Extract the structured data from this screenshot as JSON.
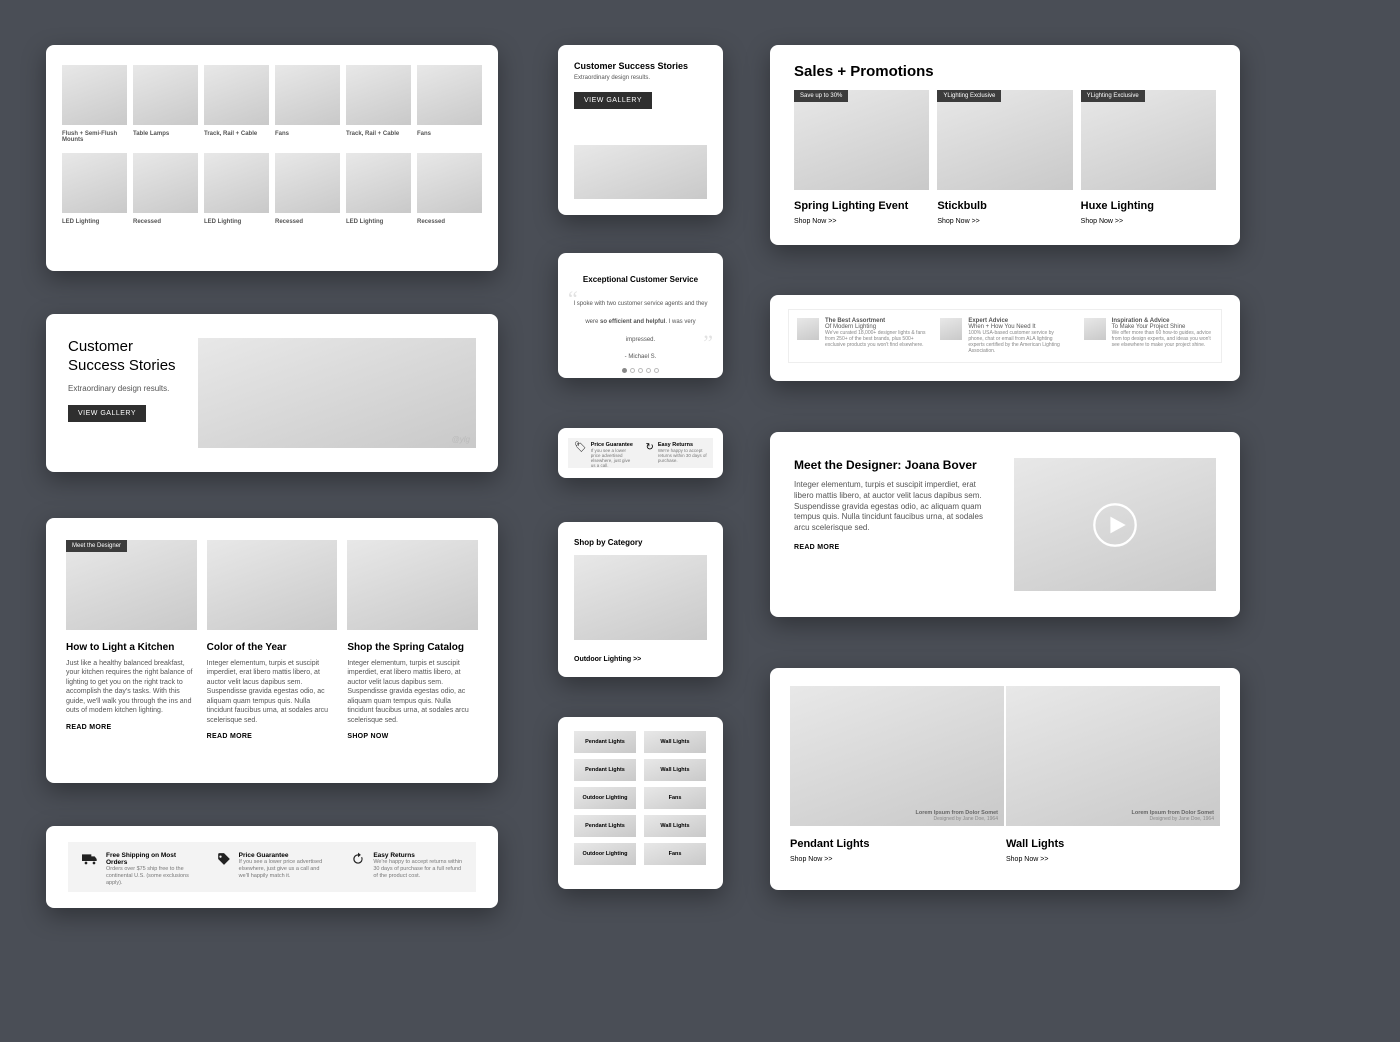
{
  "grid1": {
    "items": [
      {
        "label": "Flush + Semi-Flush Mounts"
      },
      {
        "label": "Table Lamps"
      },
      {
        "label": "Track, Rail + Cable"
      },
      {
        "label": "Fans"
      },
      {
        "label": "Track, Rail + Cable"
      },
      {
        "label": "Fans"
      },
      {
        "label": "LED Lighting"
      },
      {
        "label": "Recessed"
      },
      {
        "label": "LED Lighting"
      },
      {
        "label": "Recessed"
      },
      {
        "label": "LED Lighting"
      },
      {
        "label": "Recessed"
      }
    ]
  },
  "success_small": {
    "title": "Customer Success Stories",
    "sub": "Extraordinary design results.",
    "cta": "VIEW GALLERY"
  },
  "success_wide": {
    "title1": "Customer",
    "title2": "Success Stories",
    "sub": "Extraordinary design results.",
    "cta": "VIEW GALLERY",
    "watermark": "@ylg"
  },
  "testimonial": {
    "heading": "Exceptional Customer Service",
    "quote_pre": "I spoke with two customer service agents and they were ",
    "quote_bold": "so efficient and helpful",
    "quote_post": ". I was very impressed.",
    "author": "- Michael S."
  },
  "promos_small": {
    "items": [
      {
        "title": "Price Guarantee",
        "body": "If you see a lower price advertised elsewhere, just give us a call."
      },
      {
        "title": "Easy Returns",
        "body": "We're happy to accept returns within 30 days of purchase."
      }
    ]
  },
  "sales": {
    "heading": "Sales + Promotions",
    "items": [
      {
        "tag": "Save up to 30%",
        "title": "Spring Lighting Event",
        "cta": "Shop Now >>"
      },
      {
        "tag": "YLighting Exclusive",
        "title": "Stickbulb",
        "cta": "Shop Now >>"
      },
      {
        "tag": "YLighting Exclusive",
        "title": "Huxe Lighting",
        "cta": "Shop Now >>"
      }
    ]
  },
  "infostrip": {
    "items": [
      {
        "t1": "The Best  Assortment",
        "t2": "Of Modern Lighting",
        "body": "We've curated 18,000+ designer lights & fans from 250+ of the best brands, plus 500+ exclusive products you won't find elsewhere."
      },
      {
        "t1": "Expert Advice",
        "t2": "When + How You Need It",
        "body": "100% USA-based customer service by phone, chat or email from ALA lighting experts certified by the American Lighting Association."
      },
      {
        "t1": "Inspiration & Advice",
        "t2": "To Make Your Project Shine",
        "body": "We offer more than 60 how-to guides, advice from top design experts, and ideas you won't see elsewhere to make your project shine."
      }
    ]
  },
  "designer": {
    "heading": "Meet the Designer: Joana Bover",
    "body": "Integer elementum, turpis et suscipit imperdiet, erat libero mattis libero, at auctor velit lacus dapibus sem. Suspendisse gravida egestas odio, ac aliquam quam tempus quis. Nulla tincidunt faucibus urna, at sodales arcu scelerisque sed.",
    "cta": "READ MORE"
  },
  "articles": {
    "tag": "Meet the Designer",
    "items": [
      {
        "title": "How to Light a Kitchen",
        "body": "Just like a healthy balanced breakfast, your kitchen requires the right balance of lighting to get you on the right track to accomplish the day's tasks. With this guide, we'll walk you through the ins and outs of modern kitchen lighting.",
        "cta": "READ MORE"
      },
      {
        "title": "Color of the Year",
        "body": "Integer elementum, turpis et suscipit imperdiet, erat libero mattis libero, at auctor velit lacus dapibus sem. Suspendisse gravida egestas odio, ac aliquam quam tempus quis. Nulla tincidunt faucibus urna, at sodales arcu scelerisque sed.",
        "cta": "READ MORE"
      },
      {
        "title": "Shop the Spring Catalog",
        "body": "Integer elementum, turpis et suscipit imperdiet, erat libero mattis libero, at auctor velit lacus dapibus sem. Suspendisse gravida egestas odio, ac aliquam quam tempus quis. Nulla tincidunt faucibus urna, at sodales arcu scelerisque sed.",
        "cta": "SHOP NOW"
      }
    ]
  },
  "shopcat": {
    "title": "Shop by Category",
    "link": "Outdoor Lighting >>"
  },
  "catgrid": {
    "items": [
      "Pendant Lights",
      "Wall Lights",
      "Pendant Lights",
      "Wall Lights",
      "Outdoor Lighting",
      "Fans",
      "Pendant Lights",
      "Wall Lights",
      "Outdoor Lighting",
      "Fans"
    ]
  },
  "dual": {
    "caption1": "Lorem Ipsum from Dolor Somet",
    "caption2": "Designed by Jane Doe, 1964",
    "items": [
      {
        "title": "Pendant Lights",
        "cta": "Shop Now >>"
      },
      {
        "title": "Wall Lights",
        "cta": "Shop Now >>"
      }
    ]
  },
  "benefits": {
    "items": [
      {
        "title": "Free Shipping on Most Orders",
        "body": "Orders over $75 ship free to the continental U.S. (some exclusions apply)."
      },
      {
        "title": "Price Guarantee",
        "body": "If you see a lower price advertised elsewhere, just give us a call and we'll happily match it."
      },
      {
        "title": "Easy Returns",
        "body": "We're happy to accept returns within 30 days of purchase for a full refund of the product cost."
      }
    ]
  }
}
